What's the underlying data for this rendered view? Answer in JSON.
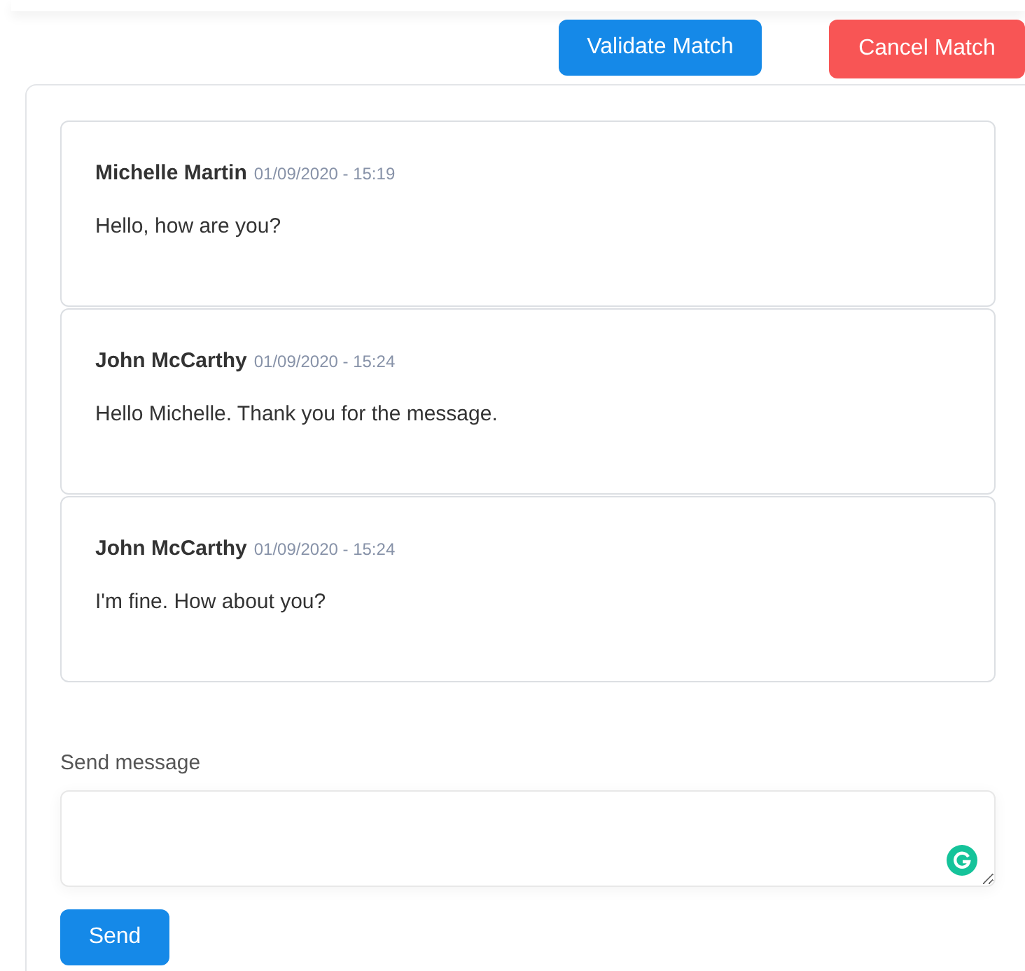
{
  "actions": [
    {
      "label": "Validate Match",
      "kind": "validate"
    },
    {
      "label": "Cancel Match",
      "kind": "cancel"
    }
  ],
  "messages": [
    {
      "author": "Michelle Martin",
      "time": "01/09/2020 - 15:19",
      "text": "Hello, how are you?"
    },
    {
      "author": "John McCarthy",
      "time": "01/09/2020 - 15:24",
      "text": "Hello Michelle. Thank you for the message."
    },
    {
      "author": "John McCarthy",
      "time": "01/09/2020 - 15:24",
      "text": "I'm fine. How about you?"
    }
  ],
  "composer": {
    "label": "Send message",
    "button": "Send"
  }
}
